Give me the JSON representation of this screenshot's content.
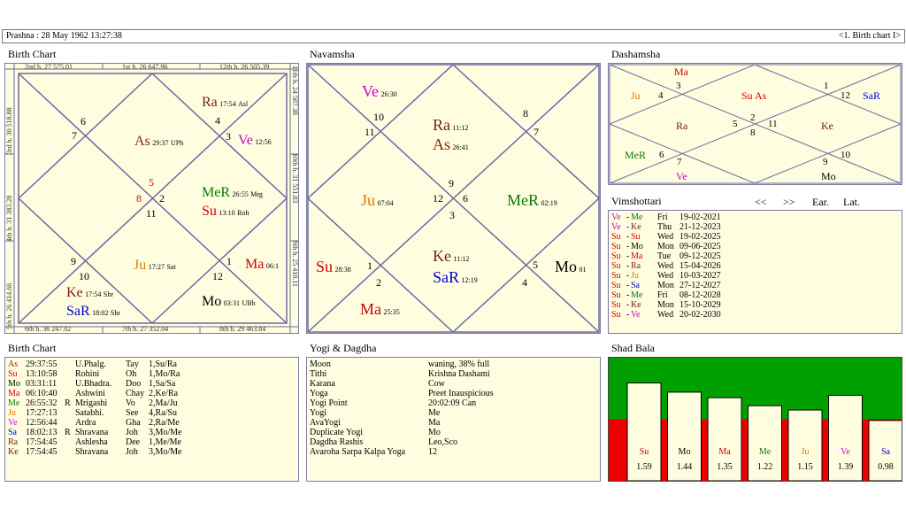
{
  "header": {
    "prashna": "Prashna :   28 May 1962  13:27:38",
    "chart_select": "<1. Birth chart I>"
  },
  "titles": {
    "birth_chart": "Birth Chart",
    "navamsha": "Navamsha",
    "dashamsha": "Dashamsha",
    "vimshottari": "Vimshottari",
    "birth_chart_table": "Birth Chart",
    "yogi": "Yogi & Dagdha",
    "shad_bala": "Shad Bala"
  },
  "colors": {
    "As": "#8b2500",
    "Su": "#d00000",
    "Mo": "#000000",
    "Ma": "#d00000",
    "Me": "#008000",
    "Ju": "#e07800",
    "Ve": "#cc00cc",
    "Sa": "#0000d0",
    "Ra": "#7a1a1a",
    "Ke": "#7a1a1a",
    "SaR": "#0000d0",
    "MeR": "#008000"
  },
  "birth_chart": {
    "cusps": {
      "h2": "2nd h.  27  575.01",
      "h1": "1st h.  26  647.96",
      "h12": "12th h.  26  505.39",
      "h6": "6th h.  36  247.02",
      "h7": "7th h.  27  352.04",
      "h8": "8th h.  29  463.84",
      "h3": "3rd h.  30  518.88",
      "h4": "4th h.  31  383.28",
      "h5": "5th h.  26  414.66",
      "h11": "11th h.  24  587.38",
      "h10": "10th h.  31  551.83",
      "h9": "9th h.  25  410.11"
    },
    "signs": {
      "s6": "6",
      "s7": "7",
      "s4": "4",
      "s3": "3",
      "s5": "5",
      "s8": "8",
      "s2": "2",
      "s11": "11",
      "s9": "9",
      "s10": "10",
      "s1": "1",
      "s12": "12"
    },
    "planets": {
      "ra": {
        "name": "Ra",
        "deg": "17:54",
        "nak": "Asl"
      },
      "as": {
        "name": "As",
        "deg": "29:37",
        "nak": "UPh"
      },
      "ve": {
        "name": "Ve",
        "deg": "12:56",
        "nak": ""
      },
      "mer": {
        "name": "MeR",
        "deg": "26:55",
        "nak": "Mrg"
      },
      "su": {
        "name": "Su",
        "deg": "13:10",
        "nak": "Roh"
      },
      "ju": {
        "name": "Ju",
        "deg": "17:27",
        "nak": "Sat"
      },
      "ma": {
        "name": "Ma",
        "deg": "06:1",
        "nak": ""
      },
      "ke": {
        "name": "Ke",
        "deg": "17:54",
        "nak": "Shr"
      },
      "sar": {
        "name": "SaR",
        "deg": "18:02",
        "nak": "Shr"
      },
      "mo": {
        "name": "Mo",
        "deg": "03:31",
        "nak": "UBh"
      }
    }
  },
  "navamsha": {
    "signs": {
      "s10": "10",
      "s11": "11",
      "s8": "8",
      "s7": "7",
      "s9": "9",
      "s12": "12",
      "s6": "6",
      "s3": "3",
      "s1": "1",
      "s2": "2",
      "s5": "5",
      "s4": "4"
    },
    "planets": {
      "ve": {
        "name": "Ve",
        "deg": "26:30"
      },
      "ra": {
        "name": "Ra",
        "deg": "11:12"
      },
      "as": {
        "name": "As",
        "deg": "26:41"
      },
      "ju": {
        "name": "Ju",
        "deg": "07:04"
      },
      "mer": {
        "name": "MeR",
        "deg": "02:19"
      },
      "su": {
        "name": "Su",
        "deg": "28:38"
      },
      "ke": {
        "name": "Ke",
        "deg": "11:12"
      },
      "sar": {
        "name": "SaR",
        "deg": "12:19"
      },
      "mo": {
        "name": "Mo",
        "deg": "01"
      },
      "ma": {
        "name": "Ma",
        "deg": "25:35"
      }
    }
  },
  "dashamsha": {
    "signs": {
      "s3": "3",
      "s4": "4",
      "s1": "1",
      "s12": "12",
      "s5": "5",
      "s2": "2",
      "s8": "8",
      "s11": "11",
      "s6": "6",
      "s7": "7",
      "s9": "9",
      "s10": "10"
    },
    "planets": {
      "ma": "Ma",
      "ju": "Ju",
      "suas": "Su As",
      "sar": "SaR",
      "ra": "Ra",
      "ke": "Ke",
      "mer": "MeR",
      "ve": "Ve",
      "mo": "Mo"
    }
  },
  "vimshottari": {
    "nav_prev": "<<",
    "nav_next": ">>",
    "ear": "Ear.",
    "lat": "Lat.",
    "rows": [
      {
        "a": "Ve",
        "b": "Me",
        "day": "Fri",
        "date": "19-02-2021"
      },
      {
        "a": "Ve",
        "b": "Ke",
        "day": "Thu",
        "date": "21-12-2023"
      },
      {
        "a": "Su",
        "b": "Su",
        "day": "Wed",
        "date": "19-02-2025"
      },
      {
        "a": "Su",
        "b": "Mo",
        "day": "Mon",
        "date": "09-06-2025"
      },
      {
        "a": "Su",
        "b": "Ma",
        "day": "Tue",
        "date": "09-12-2025"
      },
      {
        "a": "Su",
        "b": "Ra",
        "day": "Wed",
        "date": "15-04-2026"
      },
      {
        "a": "Su",
        "b": "Ju",
        "day": "Wed",
        "date": "10-03-2027"
      },
      {
        "a": "Su",
        "b": "Sa",
        "day": "Mon",
        "date": "27-12-2027"
      },
      {
        "a": "Su",
        "b": "Me",
        "day": "Fri",
        "date": "08-12-2028"
      },
      {
        "a": "Su",
        "b": "Ke",
        "day": "Mon",
        "date": "15-10-2029"
      },
      {
        "a": "Su",
        "b": "Ve",
        "day": "Wed",
        "date": "20-02-2030"
      }
    ]
  },
  "birth_table": [
    {
      "p": "As",
      "deg": "29:37:55",
      "r": "",
      "nak": "U.Phalg.",
      "syl": "Tay",
      "pada": "1,Su/Ra"
    },
    {
      "p": "Su",
      "deg": "13:10:58",
      "r": "",
      "nak": "Rohini",
      "syl": "Oh",
      "pada": "1,Mo/Ra"
    },
    {
      "p": "Mo",
      "deg": "03:31:11",
      "r": "",
      "nak": "U.Bhadra.",
      "syl": "Doo",
      "pada": "1,Sa/Sa"
    },
    {
      "p": "Ma",
      "deg": "06:10:40",
      "r": "",
      "nak": "Ashwini",
      "syl": "Chay",
      "pada": "2,Ke/Ra"
    },
    {
      "p": "Me",
      "deg": "26:55:32",
      "r": "R",
      "nak": "Mrigashi",
      "syl": "Vo",
      "pada": "2,Ma/Ju"
    },
    {
      "p": "Ju",
      "deg": "17:27:13",
      "r": "",
      "nak": "Satabhi.",
      "syl": "See",
      "pada": "4,Ra/Su"
    },
    {
      "p": "Ve",
      "deg": "12:56:44",
      "r": "",
      "nak": "Ardra",
      "syl": "Gha",
      "pada": "2,Ra/Me"
    },
    {
      "p": "Sa",
      "deg": "18:02:13",
      "r": "R",
      "nak": "Shravana",
      "syl": "Joh",
      "pada": "3,Mo/Me"
    },
    {
      "p": "Ra",
      "deg": "17:54:45",
      "r": "",
      "nak": "Ashlesha",
      "syl": "Dee",
      "pada": "1,Me/Me"
    },
    {
      "p": "Ke",
      "deg": "17:54:45",
      "r": "",
      "nak": "Shravana",
      "syl": "Joh",
      "pada": "3,Mo/Me"
    }
  ],
  "yogi_table": [
    {
      "k": "Moon",
      "v": "waning, 38% full"
    },
    {
      "k": "Tithi",
      "v": "Krishna  Dashami"
    },
    {
      "k": "Karana",
      "v": "Cow"
    },
    {
      "k": "Yoga",
      "v": "Preet Inauspicious"
    },
    {
      "k": "Yogi Point",
      "v": "20:02:09 Can"
    },
    {
      "k": "Yogi",
      "v": "Me"
    },
    {
      "k": "AvaYogi",
      "v": "Ma"
    },
    {
      "k": "Duplicate Yogi",
      "v": "Mo"
    },
    {
      "k": "Dagdha Rashis",
      "v": "Leo,Sco"
    },
    {
      "k": "Avaroha Sarpa Kalpa Yoga",
      "v": "12"
    }
  ],
  "chart_data": {
    "type": "bar",
    "title": "Shad Bala",
    "categories": [
      "Su",
      "Mo",
      "Ma",
      "Me",
      "Ju",
      "Ve",
      "Sa"
    ],
    "values": [
      1.59,
      1.44,
      1.35,
      1.22,
      1.15,
      1.39,
      0.98
    ],
    "value_labels": [
      "1.59",
      "1.44",
      "1.35",
      "1.22",
      "1.15",
      "1.39",
      "0.98"
    ],
    "threshold": 1.0,
    "ylim": [
      0,
      2.0
    ],
    "above_color": "#00a000",
    "below_color": "#ee0000"
  }
}
